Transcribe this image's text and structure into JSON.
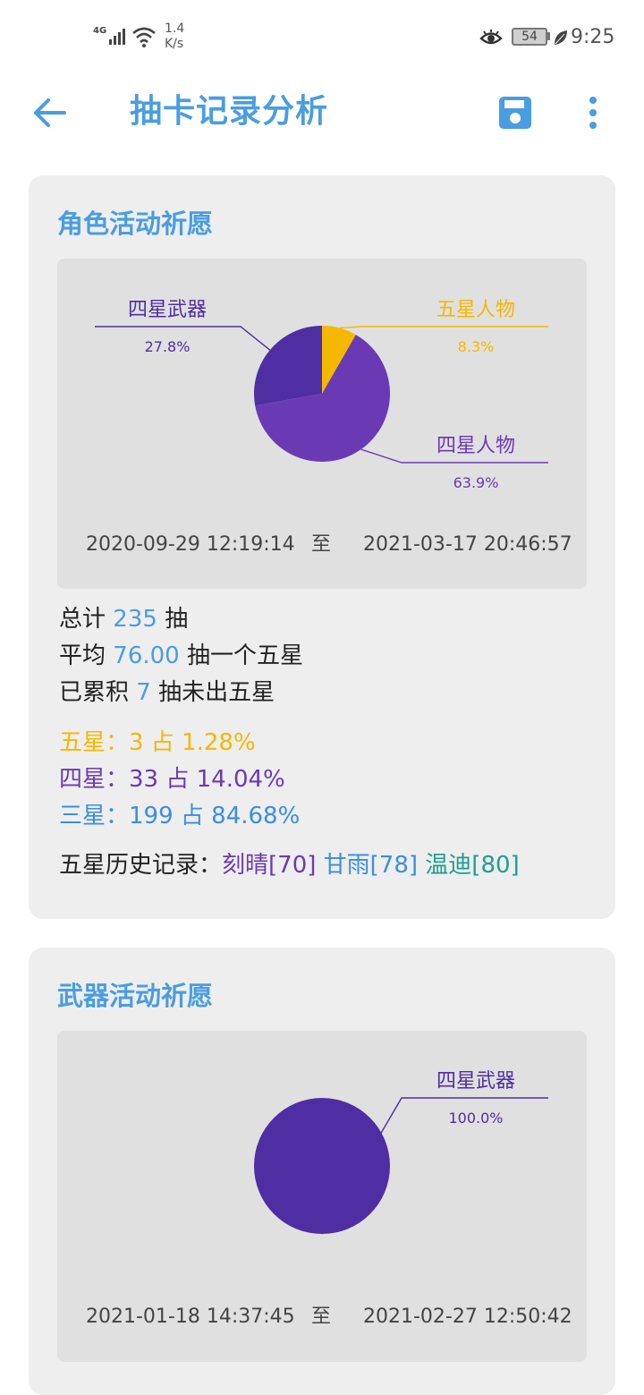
{
  "status_bar": {
    "network_type": "4G",
    "speed_value": "1.4",
    "speed_unit": "K/s",
    "battery": "54",
    "time": "9:25"
  },
  "toolbar": {
    "title": "抽卡记录分析"
  },
  "colors": {
    "accent": "#4a9de0",
    "five_star": "#f5b800",
    "four_star_character": "#6a3ab4",
    "four_star_weapon": "#4f2ea3",
    "three_star": "#3a8ee0",
    "teal": "#1f9e8f"
  },
  "character_banner": {
    "title": "角色活动祈愿",
    "chart_data": {
      "type": "pie",
      "slices": [
        {
          "label": "五星人物",
          "percent": "8.3%",
          "value": 8.3
        },
        {
          "label": "四星人物",
          "percent": "63.9%",
          "value": 63.9
        },
        {
          "label": "四星武器",
          "percent": "27.8%",
          "value": 27.8
        }
      ]
    },
    "date_from": "2020-09-29 12:19:14",
    "date_sep": "至",
    "date_to": "2021-03-17 20:46:57",
    "stats": {
      "total_prefix": "总计",
      "total": "235",
      "total_suffix": "抽",
      "avg_prefix": "平均",
      "avg": "76.00",
      "avg_suffix": "抽一个五星",
      "accum_prefix": "已累积",
      "accum": "7",
      "accum_suffix": "抽未出五星"
    },
    "rarity": {
      "five": "五星：3 占 1.28%",
      "four": "四星：33 占 14.04%",
      "three": "三星：199 占 84.68%"
    },
    "history_label": "五星历史记录：",
    "history": [
      "刻晴[70]",
      "甘雨[78]",
      "温迪[80]"
    ]
  },
  "weapon_banner": {
    "title": "武器活动祈愿",
    "chart_data": {
      "type": "pie",
      "slices": [
        {
          "label": "四星武器",
          "percent": "100.0%",
          "value": 100.0
        }
      ]
    },
    "date_from": "2021-01-18 14:37:45",
    "date_sep": "至",
    "date_to": "2021-02-27 12:50:42"
  }
}
